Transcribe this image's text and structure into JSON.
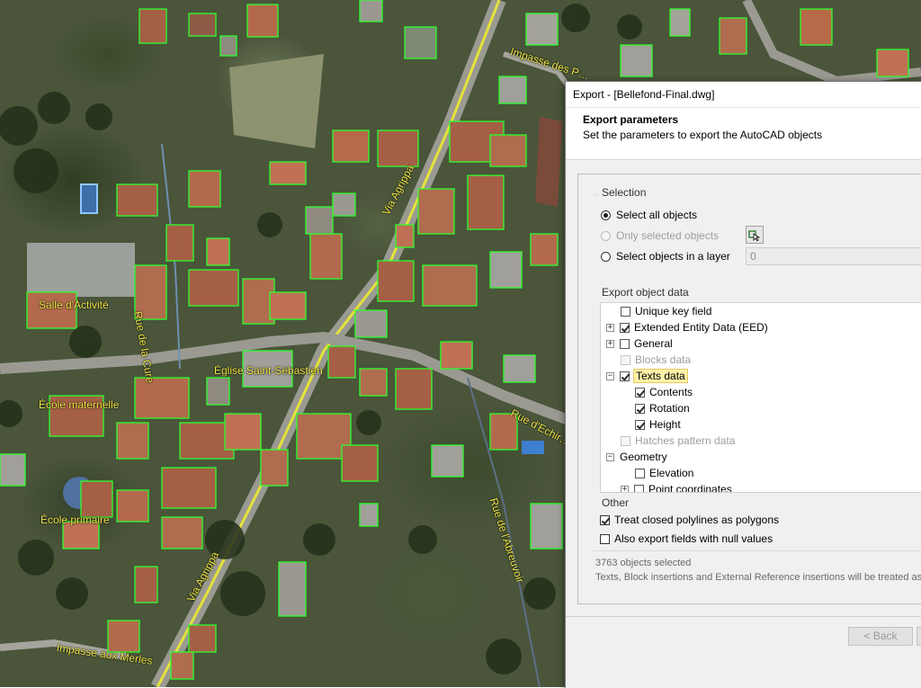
{
  "map": {
    "labels": [
      "Salle d'Activité",
      "Rue de la Cure",
      "Église Saint-Sébastien",
      "École maternelle",
      "École primaire",
      "Via Agrippa",
      "Via Agrippa",
      "Impasse aux Merles",
      "Impasse des P…",
      "Rue d'Echir…",
      "Rue de l'Abreuvoir"
    ]
  },
  "dialog": {
    "title": "Export - [Bellefond-Final.dwg]",
    "header_title": "Export parameters",
    "header_subtitle": "Set the parameters to export the AutoCAD objects",
    "selection": {
      "group_label": "Selection",
      "options": [
        {
          "label": "Select all objects",
          "checked": true,
          "enabled": true
        },
        {
          "label": "Only selected objects",
          "checked": false,
          "enabled": false
        },
        {
          "label": "Select objects in a layer",
          "checked": false,
          "enabled": true
        }
      ],
      "layer_value": "0"
    },
    "object_data": {
      "group_label": "Export object data",
      "items": [
        {
          "label": "Unique key field",
          "checked": false,
          "enabled": true,
          "expander": ""
        },
        {
          "label": "Extended Entity Data (EED)",
          "checked": true,
          "enabled": true,
          "expander": "+"
        },
        {
          "label": "General",
          "checked": false,
          "enabled": true,
          "expander": "+"
        },
        {
          "label": "Blocks data",
          "checked": false,
          "enabled": false,
          "expander": ""
        },
        {
          "label": "Texts data",
          "checked": true,
          "enabled": true,
          "expander": "−"
        },
        {
          "label": "Contents",
          "checked": true,
          "enabled": true,
          "expander": ""
        },
        {
          "label": "Rotation",
          "checked": true,
          "enabled": true,
          "expander": ""
        },
        {
          "label": "Height",
          "checked": true,
          "enabled": true,
          "expander": ""
        },
        {
          "label": "Hatches pattern data",
          "checked": false,
          "enabled": false,
          "expander": ""
        },
        {
          "label": "Geometry",
          "checked": false,
          "enabled": true,
          "expander": "−"
        },
        {
          "label": "Elevation",
          "checked": false,
          "enabled": true,
          "expander": ""
        },
        {
          "label": "Point coordinates",
          "checked": false,
          "enabled": true,
          "expander": "+"
        }
      ]
    },
    "other": {
      "group_label": "Other",
      "options": [
        {
          "label": "Treat closed polylines as polygons",
          "checked": true
        },
        {
          "label": "Also export fields with null values",
          "checked": false
        }
      ]
    },
    "status": "3763 objects selected",
    "note": "Texts, Block insertions and External Reference insertions will be treated as po",
    "buttons": {
      "back": "< Back"
    }
  }
}
